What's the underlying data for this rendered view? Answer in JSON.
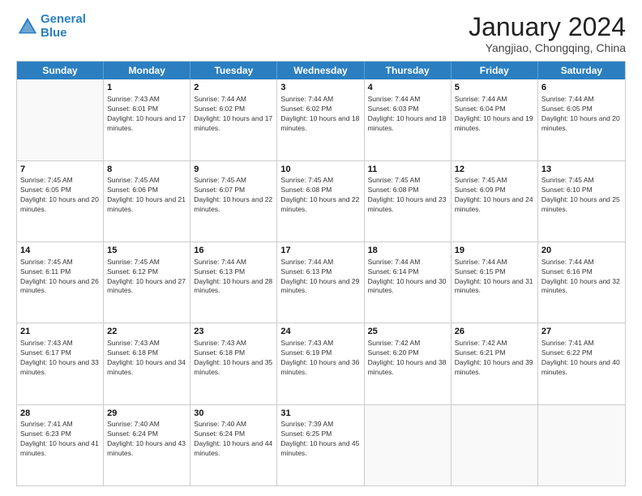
{
  "header": {
    "logo_line1": "General",
    "logo_line2": "Blue",
    "title": "January 2024",
    "subtitle": "Yangjiao, Chongqing, China"
  },
  "days_of_week": [
    "Sunday",
    "Monday",
    "Tuesday",
    "Wednesday",
    "Thursday",
    "Friday",
    "Saturday"
  ],
  "weeks": [
    [
      {
        "day": "",
        "sunrise": "",
        "sunset": "",
        "daylight": ""
      },
      {
        "day": "1",
        "sunrise": "Sunrise: 7:43 AM",
        "sunset": "Sunset: 6:01 PM",
        "daylight": "Daylight: 10 hours and 17 minutes."
      },
      {
        "day": "2",
        "sunrise": "Sunrise: 7:44 AM",
        "sunset": "Sunset: 6:02 PM",
        "daylight": "Daylight: 10 hours and 17 minutes."
      },
      {
        "day": "3",
        "sunrise": "Sunrise: 7:44 AM",
        "sunset": "Sunset: 6:02 PM",
        "daylight": "Daylight: 10 hours and 18 minutes."
      },
      {
        "day": "4",
        "sunrise": "Sunrise: 7:44 AM",
        "sunset": "Sunset: 6:03 PM",
        "daylight": "Daylight: 10 hours and 18 minutes."
      },
      {
        "day": "5",
        "sunrise": "Sunrise: 7:44 AM",
        "sunset": "Sunset: 6:04 PM",
        "daylight": "Daylight: 10 hours and 19 minutes."
      },
      {
        "day": "6",
        "sunrise": "Sunrise: 7:44 AM",
        "sunset": "Sunset: 6:05 PM",
        "daylight": "Daylight: 10 hours and 20 minutes."
      }
    ],
    [
      {
        "day": "7",
        "sunrise": "Sunrise: 7:45 AM",
        "sunset": "Sunset: 6:05 PM",
        "daylight": "Daylight: 10 hours and 20 minutes."
      },
      {
        "day": "8",
        "sunrise": "Sunrise: 7:45 AM",
        "sunset": "Sunset: 6:06 PM",
        "daylight": "Daylight: 10 hours and 21 minutes."
      },
      {
        "day": "9",
        "sunrise": "Sunrise: 7:45 AM",
        "sunset": "Sunset: 6:07 PM",
        "daylight": "Daylight: 10 hours and 22 minutes."
      },
      {
        "day": "10",
        "sunrise": "Sunrise: 7:45 AM",
        "sunset": "Sunset: 6:08 PM",
        "daylight": "Daylight: 10 hours and 22 minutes."
      },
      {
        "day": "11",
        "sunrise": "Sunrise: 7:45 AM",
        "sunset": "Sunset: 6:08 PM",
        "daylight": "Daylight: 10 hours and 23 minutes."
      },
      {
        "day": "12",
        "sunrise": "Sunrise: 7:45 AM",
        "sunset": "Sunset: 6:09 PM",
        "daylight": "Daylight: 10 hours and 24 minutes."
      },
      {
        "day": "13",
        "sunrise": "Sunrise: 7:45 AM",
        "sunset": "Sunset: 6:10 PM",
        "daylight": "Daylight: 10 hours and 25 minutes."
      }
    ],
    [
      {
        "day": "14",
        "sunrise": "Sunrise: 7:45 AM",
        "sunset": "Sunset: 6:11 PM",
        "daylight": "Daylight: 10 hours and 26 minutes."
      },
      {
        "day": "15",
        "sunrise": "Sunrise: 7:45 AM",
        "sunset": "Sunset: 6:12 PM",
        "daylight": "Daylight: 10 hours and 27 minutes."
      },
      {
        "day": "16",
        "sunrise": "Sunrise: 7:44 AM",
        "sunset": "Sunset: 6:13 PM",
        "daylight": "Daylight: 10 hours and 28 minutes."
      },
      {
        "day": "17",
        "sunrise": "Sunrise: 7:44 AM",
        "sunset": "Sunset: 6:13 PM",
        "daylight": "Daylight: 10 hours and 29 minutes."
      },
      {
        "day": "18",
        "sunrise": "Sunrise: 7:44 AM",
        "sunset": "Sunset: 6:14 PM",
        "daylight": "Daylight: 10 hours and 30 minutes."
      },
      {
        "day": "19",
        "sunrise": "Sunrise: 7:44 AM",
        "sunset": "Sunset: 6:15 PM",
        "daylight": "Daylight: 10 hours and 31 minutes."
      },
      {
        "day": "20",
        "sunrise": "Sunrise: 7:44 AM",
        "sunset": "Sunset: 6:16 PM",
        "daylight": "Daylight: 10 hours and 32 minutes."
      }
    ],
    [
      {
        "day": "21",
        "sunrise": "Sunrise: 7:43 AM",
        "sunset": "Sunset: 6:17 PM",
        "daylight": "Daylight: 10 hours and 33 minutes."
      },
      {
        "day": "22",
        "sunrise": "Sunrise: 7:43 AM",
        "sunset": "Sunset: 6:18 PM",
        "daylight": "Daylight: 10 hours and 34 minutes."
      },
      {
        "day": "23",
        "sunrise": "Sunrise: 7:43 AM",
        "sunset": "Sunset: 6:18 PM",
        "daylight": "Daylight: 10 hours and 35 minutes."
      },
      {
        "day": "24",
        "sunrise": "Sunrise: 7:43 AM",
        "sunset": "Sunset: 6:19 PM",
        "daylight": "Daylight: 10 hours and 36 minutes."
      },
      {
        "day": "25",
        "sunrise": "Sunrise: 7:42 AM",
        "sunset": "Sunset: 6:20 PM",
        "daylight": "Daylight: 10 hours and 38 minutes."
      },
      {
        "day": "26",
        "sunrise": "Sunrise: 7:42 AM",
        "sunset": "Sunset: 6:21 PM",
        "daylight": "Daylight: 10 hours and 39 minutes."
      },
      {
        "day": "27",
        "sunrise": "Sunrise: 7:41 AM",
        "sunset": "Sunset: 6:22 PM",
        "daylight": "Daylight: 10 hours and 40 minutes."
      }
    ],
    [
      {
        "day": "28",
        "sunrise": "Sunrise: 7:41 AM",
        "sunset": "Sunset: 6:23 PM",
        "daylight": "Daylight: 10 hours and 41 minutes."
      },
      {
        "day": "29",
        "sunrise": "Sunrise: 7:40 AM",
        "sunset": "Sunset: 6:24 PM",
        "daylight": "Daylight: 10 hours and 43 minutes."
      },
      {
        "day": "30",
        "sunrise": "Sunrise: 7:40 AM",
        "sunset": "Sunset: 6:24 PM",
        "daylight": "Daylight: 10 hours and 44 minutes."
      },
      {
        "day": "31",
        "sunrise": "Sunrise: 7:39 AM",
        "sunset": "Sunset: 6:25 PM",
        "daylight": "Daylight: 10 hours and 45 minutes."
      },
      {
        "day": "",
        "sunrise": "",
        "sunset": "",
        "daylight": ""
      },
      {
        "day": "",
        "sunrise": "",
        "sunset": "",
        "daylight": ""
      },
      {
        "day": "",
        "sunrise": "",
        "sunset": "",
        "daylight": ""
      }
    ]
  ]
}
